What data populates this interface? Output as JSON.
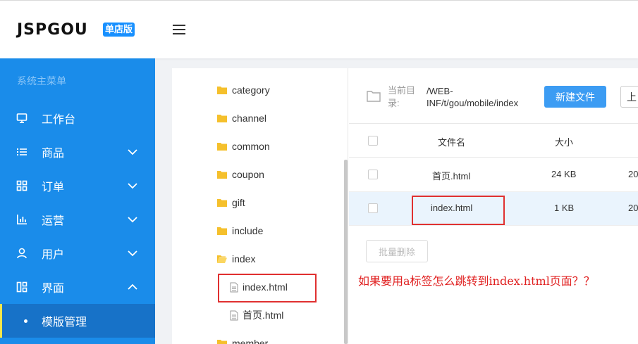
{
  "header": {
    "logo_text": "JSPGOU",
    "logo_badge": "单店版",
    "menu_icon": "hamburger-icon"
  },
  "sidebar": {
    "title": "系统主菜单",
    "items": [
      {
        "label": "工作台",
        "icon": "monitor-icon",
        "arrow": ""
      },
      {
        "label": "商品",
        "icon": "list-icon",
        "arrow": "chevron-down"
      },
      {
        "label": "订单",
        "icon": "grid-icon",
        "arrow": "chevron-down"
      },
      {
        "label": "运营",
        "icon": "bar-chart-icon",
        "arrow": "chevron-down"
      },
      {
        "label": "用户",
        "icon": "user-icon",
        "arrow": "chevron-down"
      },
      {
        "label": "界面",
        "icon": "layout-icon",
        "arrow": "chevron-up"
      }
    ],
    "sub_item": {
      "label": "模版管理"
    },
    "colors": {
      "bg": "#1a8cea",
      "active_bg": "#1772c8",
      "active_marker": "#f7e64a"
    }
  },
  "tree": {
    "folders": [
      "category",
      "channel",
      "common",
      "coupon",
      "gift",
      "include",
      "index"
    ],
    "files": [
      "index.html",
      "首页.html"
    ],
    "next_folder": "member"
  },
  "panel": {
    "path_label": "当前目录:",
    "path_value": "/WEB-INF/t/gou/mobile/index",
    "new_file_button": "新建文件",
    "upload_button": "上",
    "table": {
      "headers": {
        "name": "文件名",
        "size": "大小"
      },
      "rows": [
        {
          "name": "首页.html",
          "size": "24 KB",
          "date": "20"
        },
        {
          "name": "index.html",
          "size": "1 KB",
          "date": "20"
        }
      ]
    },
    "batch_delete_button": "批量删除"
  },
  "annotation": {
    "question": "如果要用a标签怎么跳转到index.html页面？？",
    "color": "#e02020"
  }
}
